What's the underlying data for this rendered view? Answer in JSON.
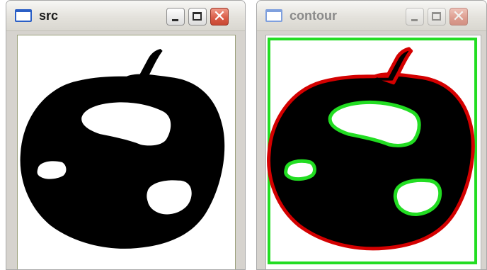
{
  "windows": [
    {
      "title": "src",
      "icon": "window-icon",
      "active": true,
      "buttons": [
        "minimize",
        "maximize",
        "close"
      ]
    },
    {
      "title": "contour",
      "icon": "window-icon",
      "active": false,
      "buttons": [
        "minimize",
        "maximize",
        "close"
      ]
    }
  ],
  "colors": {
    "apple_fill": "#000000",
    "hole_fill": "#ffffff",
    "outer_contour": "#d40000",
    "inner_contours": "#22dd22",
    "bounding_rect": "#22dd22"
  }
}
